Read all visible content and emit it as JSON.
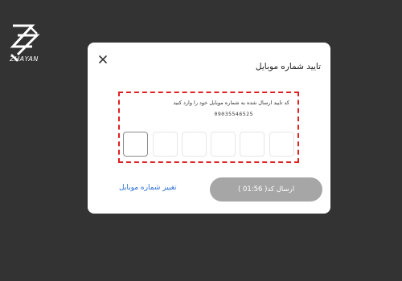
{
  "brand": {
    "name": "ZHAYAN"
  },
  "dialog": {
    "title": "تایید شماره موبایل",
    "instruction": "کد تایید ارسال شده به شماره موبایل خود را وارد کنید",
    "phone": "09035546525",
    "otp_boxes": [
      "",
      "",
      "",
      "",
      "",
      ""
    ],
    "submit_label": "ارسال کد( 01:56 )",
    "change_number_label": "تغییر شماره موبایل"
  },
  "colors": {
    "background": "#333333",
    "dialog": "#ffffff",
    "highlight_border": "#e02020",
    "submit_button": "#a6a6a6",
    "link": "#2b6fd6"
  },
  "icons": {
    "close": "close-icon",
    "logo": "zhayan-logo-icon"
  }
}
